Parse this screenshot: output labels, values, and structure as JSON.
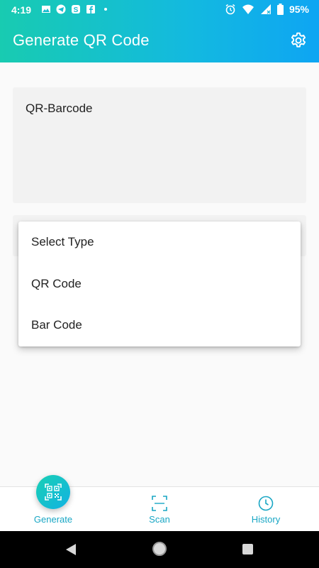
{
  "status_bar": {
    "time": "4:19",
    "left_icons": [
      "image-icon",
      "telegram-icon",
      "skype-icon",
      "facebook-icon",
      "dot-icon"
    ],
    "right_icons": [
      "alarm-icon",
      "wifi-icon",
      "signal-icon"
    ],
    "battery": "95%"
  },
  "header": {
    "title": "Generate QR Code",
    "settings_icon": "gear-icon"
  },
  "form": {
    "text_value": "QR-Barcode",
    "select_options": [
      "Select Type",
      "QR Code",
      "Bar Code"
    ]
  },
  "bottom_nav": {
    "items": [
      {
        "label": "Generate",
        "icon": "qr-code-icon",
        "active": true
      },
      {
        "label": "Scan",
        "icon": "scan-frame-icon"
      },
      {
        "label": "History",
        "icon": "clock-icon"
      }
    ]
  },
  "colors": {
    "gradient_start": "#18cbb1",
    "gradient_end": "#0ea5f3",
    "accent": "#18a6c4"
  }
}
